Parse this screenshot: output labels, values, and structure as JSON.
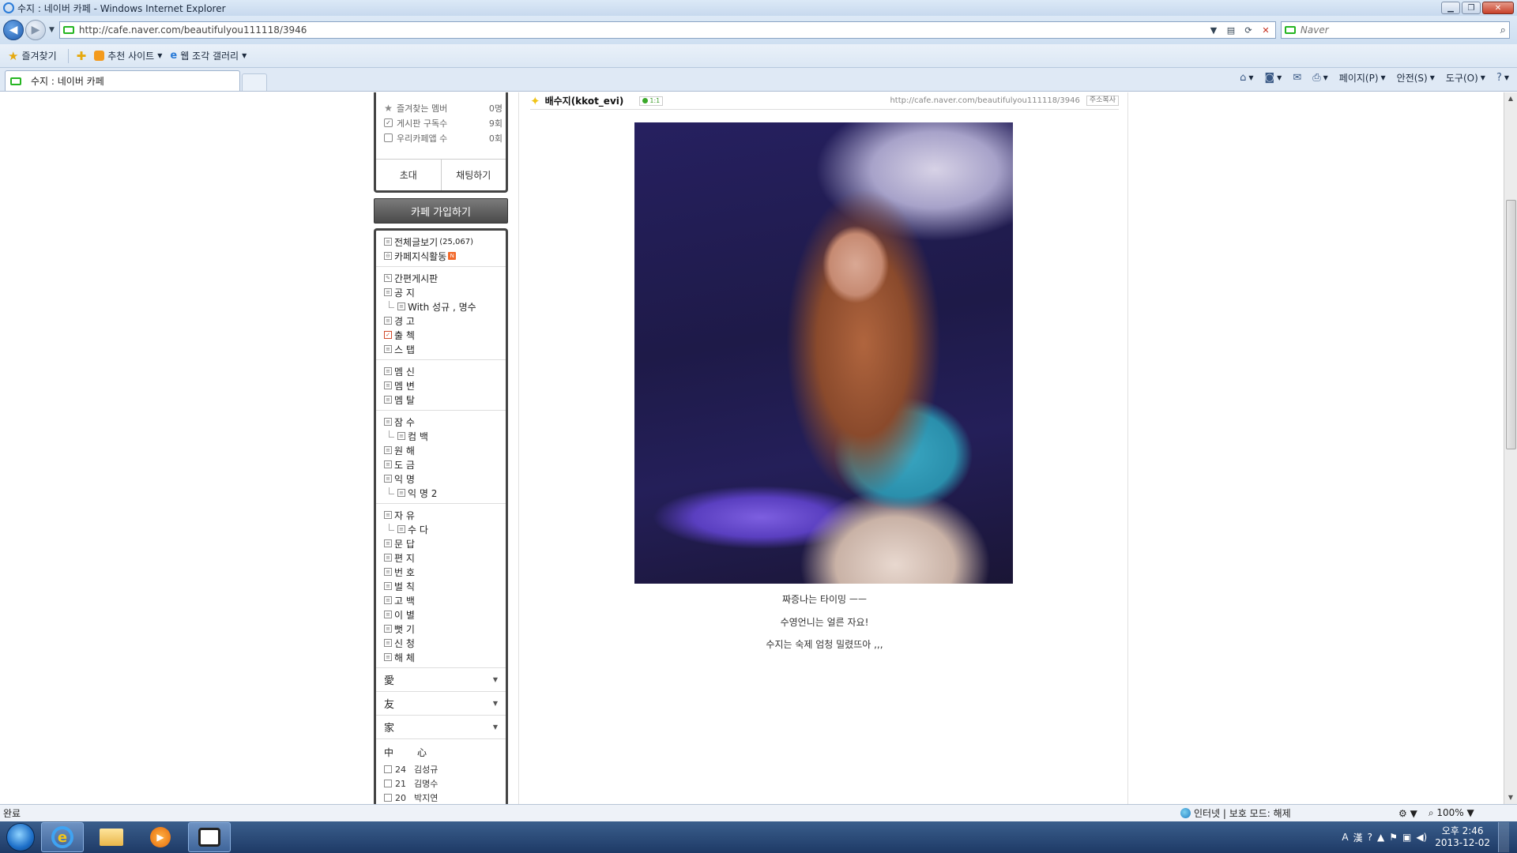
{
  "window": {
    "title": "수지 : 네이버 카페 - Windows Internet Explorer"
  },
  "address": {
    "url": "http://cafe.naver.com/beautifulyou111118/3946"
  },
  "search": {
    "placeholder": "Naver"
  },
  "favorites": {
    "label": "즐겨찾기",
    "items": [
      "추천 사이트",
      "웹 조각 갤러리"
    ]
  },
  "tab": {
    "label": "수지 : 네이버 카페"
  },
  "commands": {
    "page": "페이지(P)",
    "safety": "안전(S)",
    "tools": "도구(O)"
  },
  "sidebar": {
    "stats": [
      {
        "label": "즐겨찾는 멤버",
        "value": "0명"
      },
      {
        "label": "게시판 구독수",
        "value": "9회"
      },
      {
        "label": "우리카페앱 수",
        "value": "0회"
      }
    ],
    "invite": "초대",
    "chat": "채팅하기",
    "join": "카페 가입하기",
    "top": {
      "all_posts": "전체글보기",
      "all_posts_count": "(25,067)",
      "knowledge": "카페지식활동",
      "new_badge": "N"
    },
    "groups": [
      [
        {
          "label": "간편게시판",
          "sub": false
        },
        {
          "label": "공      지",
          "sub": false
        },
        {
          "label": "With 성규 , 명수",
          "sub": true
        },
        {
          "label": "경      고",
          "sub": false
        },
        {
          "label": "출      첵",
          "sub": false,
          "red": true
        },
        {
          "label": "스      탭",
          "sub": false
        }
      ],
      [
        {
          "label": "멤      신",
          "sub": false
        },
        {
          "label": "멤      변",
          "sub": false
        },
        {
          "label": "멤      탈",
          "sub": false
        }
      ],
      [
        {
          "label": "잠      수",
          "sub": false
        },
        {
          "label": "컴      백",
          "sub": true
        },
        {
          "label": "원      해",
          "sub": false
        },
        {
          "label": "도      금",
          "sub": false
        },
        {
          "label": "익      명",
          "sub": false
        },
        {
          "label": "익      명 2",
          "sub": true
        }
      ],
      [
        {
          "label": "자      유",
          "sub": false
        },
        {
          "label": "수      다",
          "sub": true
        },
        {
          "label": "문      답",
          "sub": false
        },
        {
          "label": "편      지",
          "sub": false
        },
        {
          "label": "번      호",
          "sub": false
        },
        {
          "label": "벌      칙",
          "sub": false
        },
        {
          "label": "고      백",
          "sub": false
        },
        {
          "label": "이      별",
          "sub": false
        },
        {
          "label": "뻣      기",
          "sub": false
        },
        {
          "label": "신      청",
          "sub": false
        },
        {
          "label": "해      체",
          "sub": false
        }
      ]
    ],
    "collapsed": [
      "愛",
      "友",
      "家"
    ],
    "rank_head": [
      "中",
      "心"
    ],
    "ranks": [
      {
        "num": "24",
        "name": "김성규"
      },
      {
        "num": "21",
        "name": "김명수"
      },
      {
        "num": "20",
        "name": "박지연"
      }
    ]
  },
  "post": {
    "author": "배수지(kkot_evi)",
    "chat_badge": "1:1",
    "url": "http://cafe.naver.com/beautifulyou111118/3946",
    "copy_label": "주소복사",
    "captions": [
      "짜증나는 타이밍 ㅡㅡ",
      "수영언니는 얼른 자요!",
      "수지는 숙제 엄청 밀렸뜨아 ,,,"
    ]
  },
  "status": {
    "left": "완료",
    "zone": "인터넷 | 보호 모드: 해제",
    "zoom": "100%"
  },
  "clock": {
    "time": "오후 2:46",
    "date": "2013-12-02"
  }
}
